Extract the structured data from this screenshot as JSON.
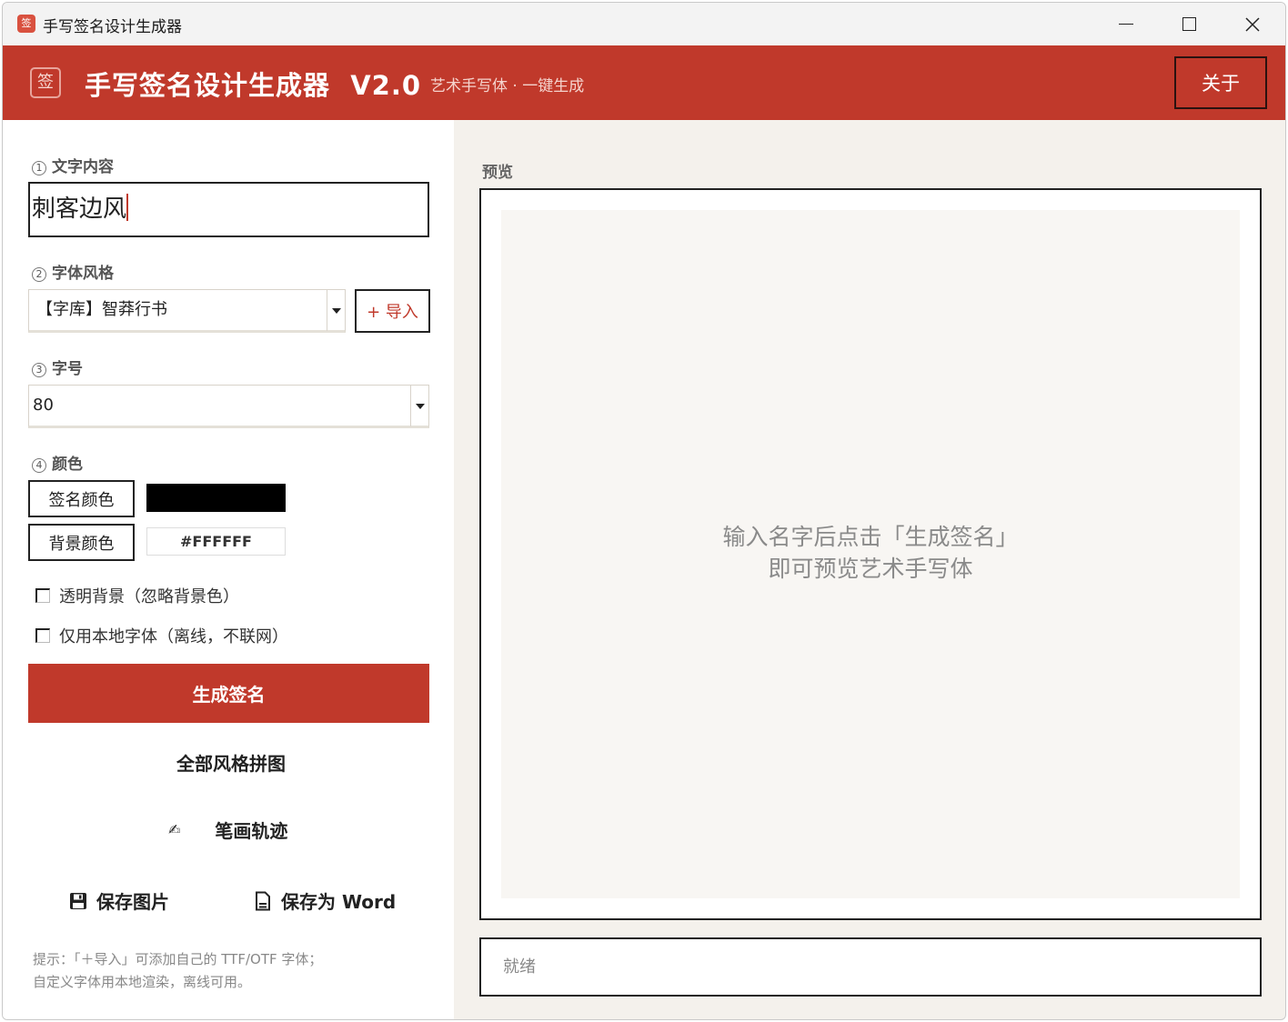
{
  "window": {
    "title": "手写签名设计生成器",
    "icon_glyph": "签"
  },
  "header": {
    "logo_glyph": "签",
    "title": "手写签名设计生成器  V2.0",
    "subtitle": "艺术手写体 · 一键生成",
    "about_label": "关于"
  },
  "form": {
    "text": {
      "num": "1",
      "label": "文字内容",
      "value": "刺客边风"
    },
    "font": {
      "num": "2",
      "label": "字体风格",
      "value": "【字库】智莽行书",
      "import_label": "+ 导入"
    },
    "size": {
      "num": "3",
      "label": "字号",
      "value": "80"
    },
    "color": {
      "num": "4",
      "label": "颜色",
      "sign_color_label": "签名颜色",
      "sign_color_value": "#000000",
      "bg_color_label": "背景颜色",
      "bg_color_value": "#FFFFFF"
    },
    "transparent_label": "透明背景（忽略背景色）",
    "local_font_label": "仅用本地字体（离线，不联网）",
    "transparent_checked": false,
    "local_font_checked": false
  },
  "actions": {
    "generate": "生成签名",
    "collage": "全部风格拼图",
    "stroke": "笔画轨迹",
    "stroke_icon": "✍",
    "save_image": "保存图片",
    "save_word": "保存为 Word"
  },
  "hint": {
    "line1": "提示：「＋导入」可添加自己的 TTF/OTF 字体；",
    "line2": "自定义字体用本地渲染，离线可用。"
  },
  "preview": {
    "label": "预览",
    "placeholder_line1": "输入名字后点击「生成签名」",
    "placeholder_line2": "即可预览艺术手写体"
  },
  "status": {
    "text": "就绪"
  },
  "colors": {
    "accent": "#c0392b",
    "panel_bg": "#f4f1ec"
  }
}
